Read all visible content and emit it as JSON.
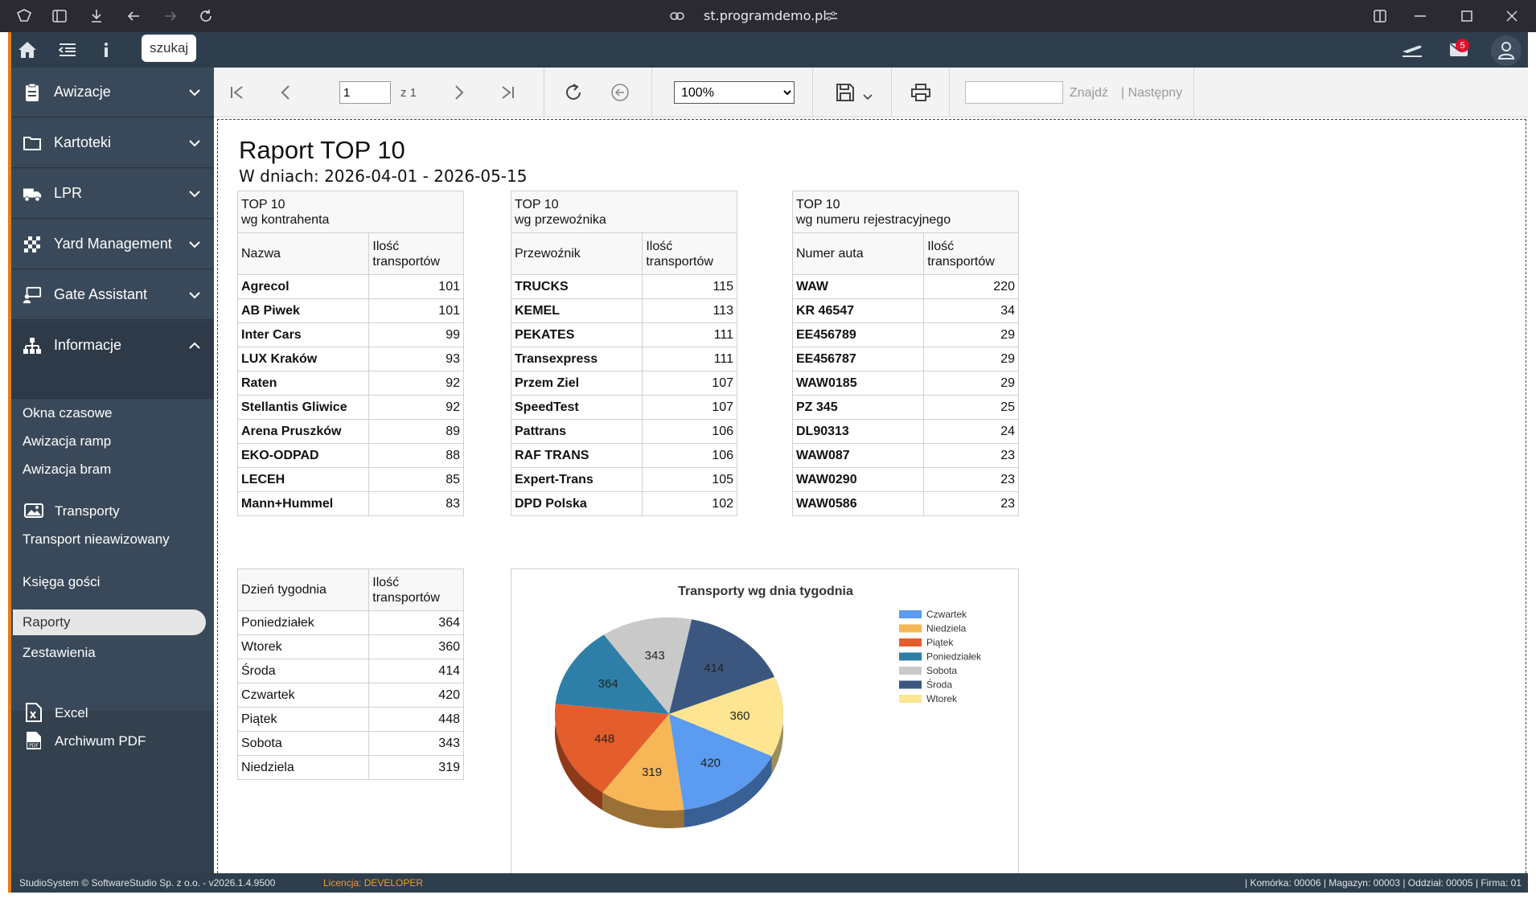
{
  "browser": {
    "url": "st.programdemo.pl"
  },
  "topbar": {
    "search_label": "szukaj",
    "mail_count": "5"
  },
  "sidebar": {
    "items": [
      {
        "label": "Awizacje"
      },
      {
        "label": "Kartoteki"
      },
      {
        "label": "LPR"
      },
      {
        "label": "Yard Management"
      },
      {
        "label": "Gate Assistant"
      },
      {
        "label": "Informacje"
      }
    ],
    "sub": {
      "okna": "Okna czasowe",
      "ramp": "Awizacja ramp",
      "bram": "Awizacja bram",
      "transporty": "Transporty",
      "nieawizowany": "Transport nieawizowany",
      "ksiega": "Księga gości",
      "raporty": "Raporty",
      "zestawienia": "Zestawienia",
      "excel": "Excel",
      "pdf": "Archiwum PDF"
    }
  },
  "toolbar": {
    "page_value": "1",
    "page_of": "z 1",
    "zoom": "100%",
    "find_label": "Znajdź",
    "next_label": "| Następny"
  },
  "report": {
    "title": "Raport TOP 10",
    "subtitle": "W dniach: 2026-04-01 - 2026-05-15",
    "contractors": {
      "title1": "TOP 10",
      "title2": "wg kontrahenta",
      "col1": "Nazwa",
      "col2a": "Ilość",
      "col2b": "transportów",
      "rows": [
        {
          "name": "Agrecol",
          "count": "101"
        },
        {
          "name": "AB Piwek",
          "count": "101"
        },
        {
          "name": "Inter Cars",
          "count": "99"
        },
        {
          "name": "LUX Kraków",
          "count": "93"
        },
        {
          "name": "Raten",
          "count": "92"
        },
        {
          "name": "Stellantis Gliwice",
          "count": "92"
        },
        {
          "name": "Arena Pruszków",
          "count": "89"
        },
        {
          "name": "EKO-ODPAD",
          "count": "88"
        },
        {
          "name": "LECEH",
          "count": "85"
        },
        {
          "name": "Mann+Hummel",
          "count": "83"
        }
      ]
    },
    "carriers": {
      "title1": "TOP 10",
      "title2": "wg przewoźnika",
      "col1": "Przewoźnik",
      "col2a": "Ilość",
      "col2b": "transportów",
      "rows": [
        {
          "name": "TRUCKS",
          "count": "115"
        },
        {
          "name": "KEMEL",
          "count": "113"
        },
        {
          "name": "PEKATES",
          "count": "111"
        },
        {
          "name": "Transexpress",
          "count": "111"
        },
        {
          "name": "Przem Ziel",
          "count": "107"
        },
        {
          "name": "SpeedTest",
          "count": "107"
        },
        {
          "name": "Pattrans",
          "count": "106"
        },
        {
          "name": "RAF TRANS",
          "count": "106"
        },
        {
          "name": "Expert-Trans",
          "count": "105"
        },
        {
          "name": "DPD Polska",
          "count": "102"
        }
      ]
    },
    "plates": {
      "title1": "TOP 10",
      "title2": "wg numeru rejestracyjnego",
      "col1": "Numer auta",
      "col2a": "Ilość",
      "col2b": "transportów",
      "rows": [
        {
          "name": "WAW",
          "count": "220"
        },
        {
          "name": "KR 46547",
          "count": "34"
        },
        {
          "name": "EE456789",
          "count": "29"
        },
        {
          "name": "EE456787",
          "count": "29"
        },
        {
          "name": "WAW0185",
          "count": "29"
        },
        {
          "name": "PZ 345",
          "count": "25"
        },
        {
          "name": "DL90313",
          "count": "24"
        },
        {
          "name": "WAW087",
          "count": "23"
        },
        {
          "name": "WAW0290",
          "count": "23"
        },
        {
          "name": "WAW0586",
          "count": "23"
        }
      ]
    },
    "weekdays": {
      "col1": "Dzień tygodnia",
      "col2a": "Ilość",
      "col2b": "transportów",
      "rows": [
        {
          "name": "Poniedziałek",
          "count": "364"
        },
        {
          "name": "Wtorek",
          "count": "360"
        },
        {
          "name": "Środa",
          "count": "414"
        },
        {
          "name": "Czwartek",
          "count": "420"
        },
        {
          "name": "Piątek",
          "count": "448"
        },
        {
          "name": "Sobota",
          "count": "343"
        },
        {
          "name": "Niedziela",
          "count": "319"
        }
      ]
    }
  },
  "chart_data": {
    "type": "pie",
    "title": "Transporty wg dnia tygodnia",
    "legend_position": "right",
    "slices": [
      {
        "label": "Czwartek",
        "value": 420,
        "color": "#5b9bf0"
      },
      {
        "label": "Niedziela",
        "value": 319,
        "color": "#f7b757"
      },
      {
        "label": "Piątek",
        "value": 448,
        "color": "#e35e2c"
      },
      {
        "label": "Poniedziałek",
        "value": 364,
        "color": "#2e7fa8"
      },
      {
        "label": "Sobota",
        "value": 343,
        "color": "#c9c9c9"
      },
      {
        "label": "Środa",
        "value": 414,
        "color": "#3b5780"
      },
      {
        "label": "Wtorek",
        "value": 360,
        "color": "#fde592"
      }
    ]
  },
  "statusbar": {
    "left": "StudioSystem © SoftwareStudio Sp. z o.o. - v2026.1.4.9500",
    "license": "Licencja: DEVELOPER",
    "right": "| Komórka: 00006 | Magazyn: 00003 | Oddział: 00005 | Firma: 01"
  }
}
